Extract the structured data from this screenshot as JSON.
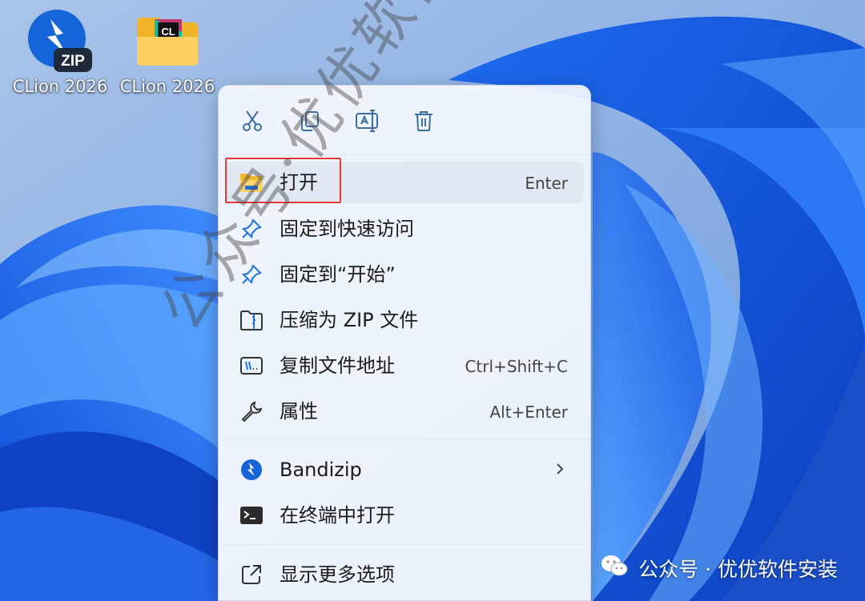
{
  "desktop": {
    "icons": [
      {
        "label": "CLion 2026",
        "icon": "bandizip-zip-archive-icon",
        "badge": "ZIP"
      },
      {
        "label": "CLion 2026",
        "icon": "folder-clion-icon",
        "badge": "CL"
      }
    ]
  },
  "context_menu": {
    "toolbar": [
      {
        "icon": "cut-icon"
      },
      {
        "icon": "copy-icon"
      },
      {
        "icon": "rename-icon"
      },
      {
        "icon": "delete-icon"
      }
    ],
    "items": [
      {
        "label": "打开",
        "shortcut": "Enter",
        "icon": "folder-icon",
        "highlighted": true
      },
      {
        "label": "固定到快速访问",
        "shortcut": "",
        "icon": "pin-icon"
      },
      {
        "label": "固定到“开始”",
        "shortcut": "",
        "icon": "pin-icon"
      },
      {
        "label": "压缩为 ZIP 文件",
        "shortcut": "",
        "icon": "zip-folder-icon"
      },
      {
        "label": "复制文件地址",
        "shortcut": "Ctrl+Shift+C",
        "icon": "copy-path-icon"
      },
      {
        "label": "属性",
        "shortcut": "Alt+Enter",
        "icon": "wrench-icon"
      },
      {
        "label": "Bandizip",
        "shortcut": "",
        "icon": "bandizip-icon",
        "submenu": true
      },
      {
        "label": "在终端中打开",
        "shortcut": "",
        "icon": "terminal-icon"
      },
      {
        "label": "显示更多选项",
        "shortcut": "",
        "icon": "more-options-icon"
      }
    ]
  },
  "watermark": {
    "diagonal": "公众号·优优软件安装",
    "footer": "公众号 · 优优软件安装"
  },
  "colors": {
    "accent_blue": "#1a73e8",
    "highlight_red": "#e53935",
    "menu_bg": "#f4f7fd"
  }
}
